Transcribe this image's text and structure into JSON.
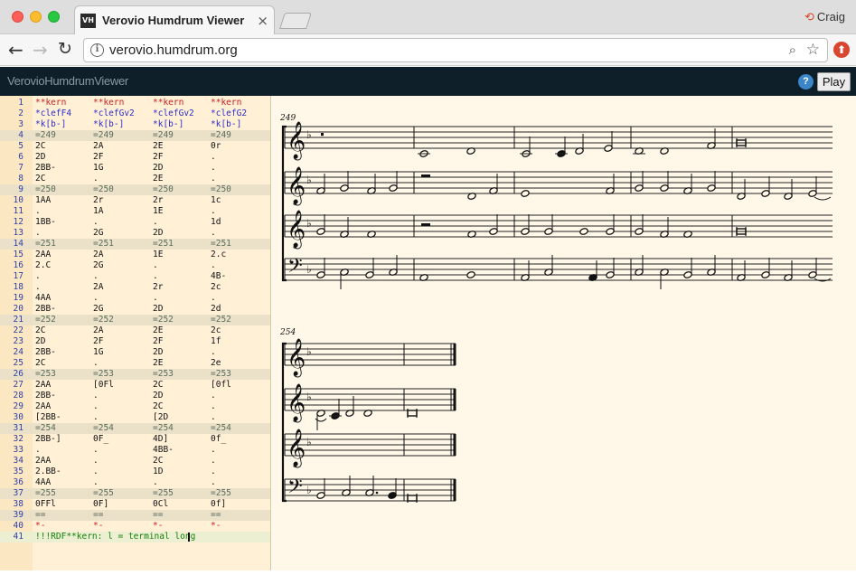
{
  "browser": {
    "tab_title": "Verovio Humdrum Viewer",
    "tab_favicon": "VH",
    "profile_name": "Craig",
    "url": "verovio.humdrum.org",
    "icons": [
      "back-icon",
      "forward-icon",
      "reload-icon",
      "info-icon",
      "zoom-icon",
      "star-icon",
      "extension-icon",
      "close-icon",
      "profile-icon"
    ]
  },
  "app": {
    "brand": "VerovioHumdrumViewer",
    "help_label": "?",
    "play_label": "Play"
  },
  "editor": {
    "lines": [
      {
        "n": "1",
        "c": [
          "**kern",
          "**kern",
          "**kern",
          "**kern"
        ],
        "t": "excl"
      },
      {
        "n": "2",
        "c": [
          "*clefF4",
          "*clefGv2",
          "*clefGv2",
          "*clefG2"
        ],
        "t": "interp"
      },
      {
        "n": "3",
        "c": [
          "*k[b-]",
          "*k[b-]",
          "*k[b-]",
          "*k[b-]"
        ],
        "t": "interp"
      },
      {
        "n": "4",
        "c": [
          "=249",
          "=249",
          "=249",
          "=249"
        ],
        "t": "bar"
      },
      {
        "n": "5",
        "c": [
          "2C",
          "2A",
          "2E",
          "0r"
        ],
        "t": "data"
      },
      {
        "n": "6",
        "c": [
          "2D",
          "2F",
          "2F",
          "."
        ],
        "t": "data"
      },
      {
        "n": "7",
        "c": [
          "2BB-",
          "1G",
          "2D",
          "."
        ],
        "t": "data"
      },
      {
        "n": "8",
        "c": [
          "2C",
          ".",
          "2E",
          "."
        ],
        "t": "data"
      },
      {
        "n": "9",
        "c": [
          "=250",
          "=250",
          "=250",
          "=250"
        ],
        "t": "bar"
      },
      {
        "n": "10",
        "c": [
          "1AA",
          "2r",
          "2r",
          "1c"
        ],
        "t": "data"
      },
      {
        "n": "11",
        "c": [
          ".",
          "1A",
          "1E",
          "."
        ],
        "t": "data"
      },
      {
        "n": "12",
        "c": [
          "1BB-",
          ".",
          ".",
          "1d"
        ],
        "t": "data"
      },
      {
        "n": "13",
        "c": [
          ".",
          "2G",
          "2D",
          "."
        ],
        "t": "data"
      },
      {
        "n": "14",
        "c": [
          "=251",
          "=251",
          "=251",
          "=251"
        ],
        "t": "bar"
      },
      {
        "n": "15",
        "c": [
          "2AA",
          "2A",
          "1E",
          "2.c"
        ],
        "t": "data"
      },
      {
        "n": "16",
        "c": [
          "2.C",
          "2G",
          ".",
          "."
        ],
        "t": "data"
      },
      {
        "n": "17",
        "c": [
          ".",
          ".",
          ".",
          "4B-"
        ],
        "t": "data"
      },
      {
        "n": "18",
        "c": [
          ".",
          "2A",
          "2r",
          "2c"
        ],
        "t": "data"
      },
      {
        "n": "19",
        "c": [
          "4AA",
          ".",
          ".",
          "."
        ],
        "t": "data"
      },
      {
        "n": "20",
        "c": [
          "2BB-",
          "2G",
          "2D",
          "2d"
        ],
        "t": "data"
      },
      {
        "n": "21",
        "c": [
          "=252",
          "=252",
          "=252",
          "=252"
        ],
        "t": "bar"
      },
      {
        "n": "22",
        "c": [
          "2C",
          "2A",
          "2E",
          "2c"
        ],
        "t": "data"
      },
      {
        "n": "23",
        "c": [
          "2D",
          "2F",
          "2F",
          "1f"
        ],
        "t": "data"
      },
      {
        "n": "24",
        "c": [
          "2BB-",
          "1G",
          "2D",
          "."
        ],
        "t": "data"
      },
      {
        "n": "25",
        "c": [
          "2C",
          ".",
          "2E",
          "2e"
        ],
        "t": "data"
      },
      {
        "n": "26",
        "c": [
          "=253",
          "=253",
          "=253",
          "=253"
        ],
        "t": "bar"
      },
      {
        "n": "27",
        "c": [
          "2AA",
          "[0Fl",
          "2C",
          "[0fl"
        ],
        "t": "data"
      },
      {
        "n": "28",
        "c": [
          "2BB-",
          ".",
          "2D",
          "."
        ],
        "t": "data"
      },
      {
        "n": "29",
        "c": [
          "2AA",
          ".",
          "2C",
          "."
        ],
        "t": "data"
      },
      {
        "n": "30",
        "c": [
          "[2BB-",
          ".",
          "[2D",
          "."
        ],
        "t": "data"
      },
      {
        "n": "31",
        "c": [
          "=254",
          "=254",
          "=254",
          "=254"
        ],
        "t": "bar"
      },
      {
        "n": "32",
        "c": [
          "2BB-]",
          "0F_",
          "4D]",
          "0f_"
        ],
        "t": "data"
      },
      {
        "n": "33",
        "c": [
          ".",
          ".",
          "4BB-",
          "."
        ],
        "t": "data"
      },
      {
        "n": "34",
        "c": [
          "2AA",
          ".",
          "2C",
          "."
        ],
        "t": "data"
      },
      {
        "n": "35",
        "c": [
          "2.BB-",
          ".",
          "1D",
          "."
        ],
        "t": "data"
      },
      {
        "n": "36",
        "c": [
          "4AA",
          ".",
          ".",
          "."
        ],
        "t": "data"
      },
      {
        "n": "37",
        "c": [
          "=255",
          "=255",
          "=255",
          "=255"
        ],
        "t": "bar"
      },
      {
        "n": "38",
        "c": [
          "0FFl",
          "0F]",
          "0Cl",
          "0f]"
        ],
        "t": "data"
      },
      {
        "n": "39",
        "c": [
          "==",
          "==",
          "==",
          "=="
        ],
        "t": "bar"
      },
      {
        "n": "40",
        "c": [
          "*-",
          "*-",
          "*-",
          "*-"
        ],
        "t": "excl"
      },
      {
        "n": "41",
        "c": [
          "!!!RDF**kern: l = terminal long"
        ],
        "t": "ref"
      }
    ]
  },
  "score": {
    "systems": [
      {
        "measure_label": "249",
        "staff_clefs": [
          "treble",
          "treble-8vb",
          "treble-8vb",
          "bass"
        ]
      },
      {
        "measure_label": "254",
        "staff_clefs": [
          "treble",
          "treble-8vb",
          "treble-8vb",
          "bass"
        ]
      }
    ],
    "key_signature": "b-flat"
  }
}
